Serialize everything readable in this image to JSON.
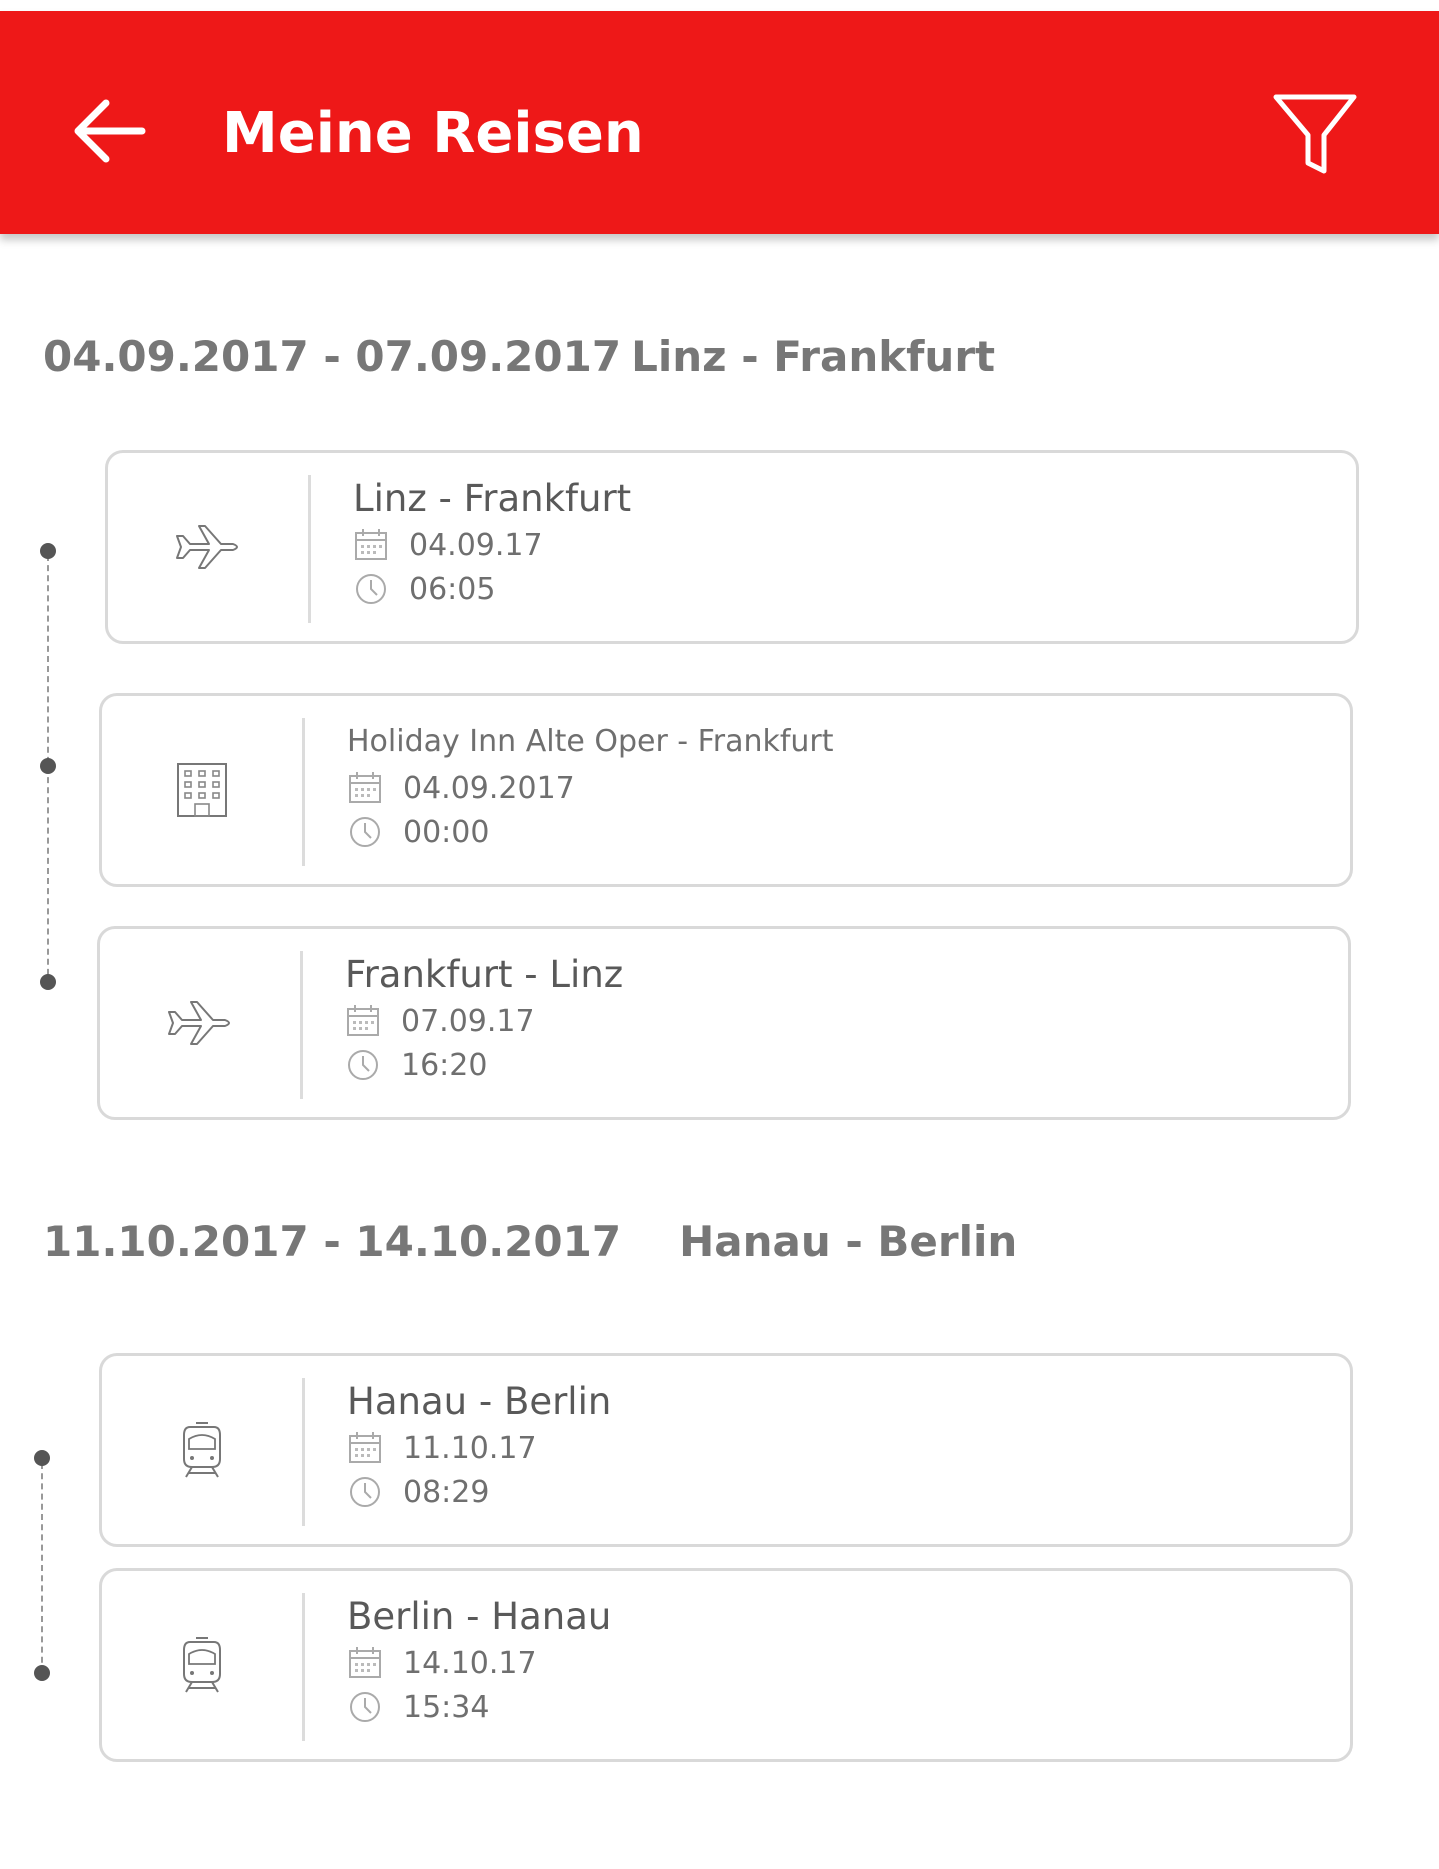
{
  "header": {
    "title": "Meine Reisen",
    "back_icon": "arrow-left-icon",
    "filter_icon": "filter-icon",
    "background_color": "#ee1818"
  },
  "trips": [
    {
      "dates": "04.09.2017 - 07.09.2017",
      "route": "Linz - Frankfurt",
      "items": [
        {
          "type": "flight",
          "icon": "airplane-icon",
          "title": "Linz - Frankfurt",
          "date": "04.09.17",
          "time": "06:05"
        },
        {
          "type": "hotel",
          "icon": "hotel-icon",
          "title": "Holiday Inn Alte Oper - Frankfurt",
          "date": "04.09.2017",
          "time": "00:00"
        },
        {
          "type": "flight",
          "icon": "airplane-icon",
          "title": "Frankfurt - Linz",
          "date": "07.09.17",
          "time": "16:20"
        }
      ]
    },
    {
      "dates": "11.10.2017 - 14.10.2017",
      "route": "Hanau - Berlin",
      "items": [
        {
          "type": "train",
          "icon": "train-icon",
          "title": "Hanau - Berlin",
          "date": "11.10.17",
          "time": "08:29"
        },
        {
          "type": "train",
          "icon": "train-icon",
          "title": "Berlin - Hanau",
          "date": "14.10.17",
          "time": "15:34"
        }
      ]
    }
  ]
}
